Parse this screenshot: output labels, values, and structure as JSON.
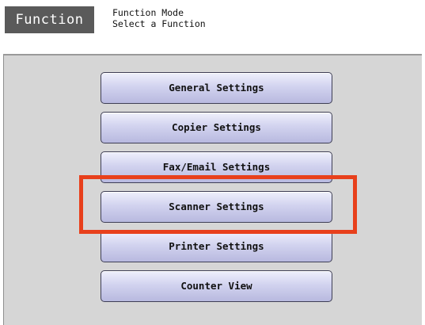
{
  "header": {
    "title": "Function",
    "mode_line1": "Function Mode",
    "mode_line2": "Select a Function"
  },
  "menu": {
    "general": "General Settings",
    "copier": "Copier Settings",
    "fax_email": "Fax/Email Settings",
    "scanner": "Scanner Settings",
    "printer": "Printer Settings",
    "counter": "Counter View"
  },
  "annotation": {
    "highlight_target": "scanner",
    "highlight_color": "#e8401c"
  },
  "colors": {
    "title_bg": "#5a5a5a",
    "panel_bg": "#d6d6d6",
    "button_face": "#d2d3ef"
  }
}
